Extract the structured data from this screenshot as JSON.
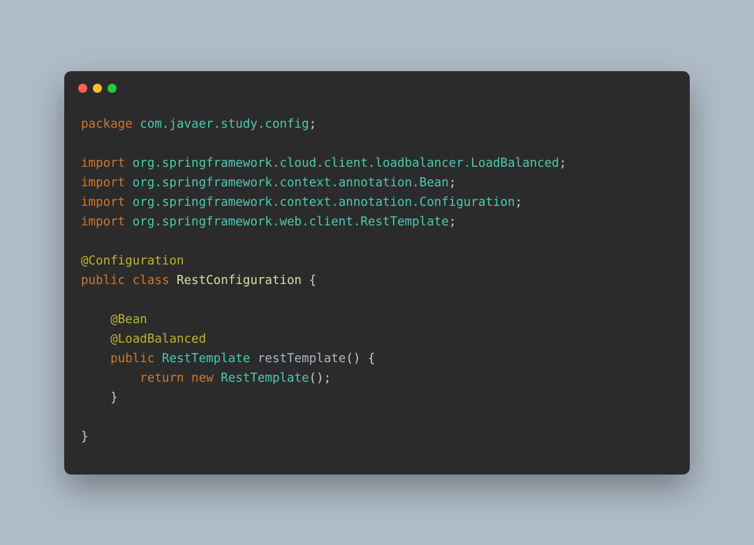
{
  "code": {
    "line1": {
      "kw": "package",
      "pkg": " com.javaer.study.config",
      "p": ";"
    },
    "line3": {
      "kw": "import",
      "pkg": " org.springframework.cloud.client.loadbalancer.LoadBalanced",
      "p": ";"
    },
    "line4": {
      "kw": "import",
      "pkg": " org.springframework.context.annotation.Bean",
      "p": ";"
    },
    "line5": {
      "kw": "import",
      "pkg": " org.springframework.context.annotation.Configuration",
      "p": ";"
    },
    "line6": {
      "kw": "import",
      "pkg": " org.springframework.web.client.RestTemplate",
      "p": ";"
    },
    "line8": {
      "ann": "@Configuration"
    },
    "line9": {
      "kw1": "public",
      "kw2": " class",
      "cls": " RestConfiguration",
      "p": " {"
    },
    "line11": {
      "indent": "    ",
      "ann": "@Bean"
    },
    "line12": {
      "indent": "    ",
      "ann": "@LoadBalanced"
    },
    "line13": {
      "indent": "    ",
      "kw": "public",
      "type": " RestTemplate",
      "method": " restTemplate",
      "p": "() {"
    },
    "line14": {
      "indent": "        ",
      "kw1": "return",
      "kw2": " new",
      "type": " RestTemplate",
      "p": "();"
    },
    "line15": {
      "indent": "    ",
      "p": "}"
    },
    "line17": {
      "p": "}"
    }
  }
}
